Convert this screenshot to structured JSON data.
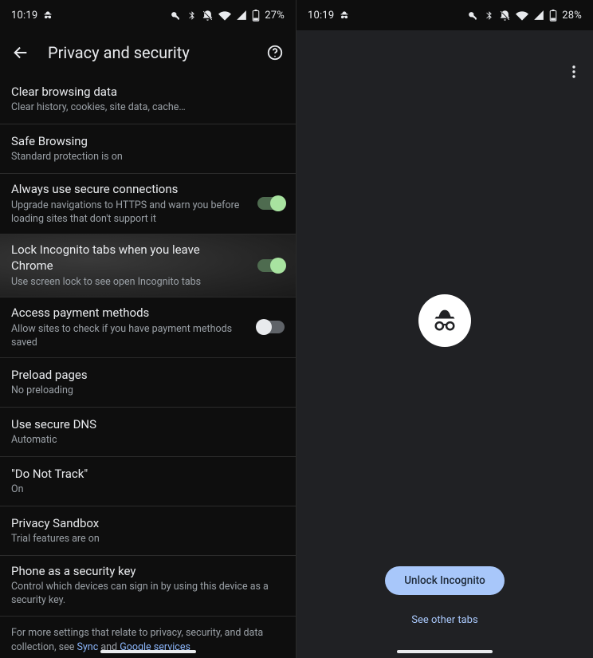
{
  "status": {
    "time": "10:19",
    "battery_left": "27%",
    "battery_right": "28%"
  },
  "left": {
    "title": "Privacy and security",
    "rows": [
      {
        "title": "Clear browsing data",
        "sub": "Clear history, cookies, site data, cache…",
        "toggle": null
      },
      {
        "title": "Safe Browsing",
        "sub": "Standard protection is on",
        "toggle": null
      },
      {
        "title": "Always use secure connections",
        "sub": "Upgrade navigations to HTTPS and warn you before loading sites that don't support it",
        "toggle": "on"
      },
      {
        "title": "Lock Incognito tabs when you leave Chrome",
        "sub": "Use screen lock to see open Incognito tabs",
        "toggle": "on",
        "highlight": true
      },
      {
        "title": "Access payment methods",
        "sub": "Allow sites to check if you have payment methods saved",
        "toggle": "off"
      },
      {
        "title": "Preload pages",
        "sub": "No preloading",
        "toggle": null
      },
      {
        "title": "Use secure DNS",
        "sub": "Automatic",
        "toggle": null
      },
      {
        "title": "\"Do Not Track\"",
        "sub": "On",
        "toggle": null
      },
      {
        "title": "Privacy Sandbox",
        "sub": "Trial features are on",
        "toggle": null
      },
      {
        "title": "Phone as a security key",
        "sub": "Control which devices can sign in by using this device as a security key.",
        "toggle": null
      }
    ],
    "footer_pre": "For more settings that relate to privacy, security, and data collection, see ",
    "footer_link1": "Sync",
    "footer_mid": " and ",
    "footer_link2": "Google services"
  },
  "right": {
    "unlock_label": "Unlock Incognito",
    "see_other_label": "See other tabs"
  }
}
